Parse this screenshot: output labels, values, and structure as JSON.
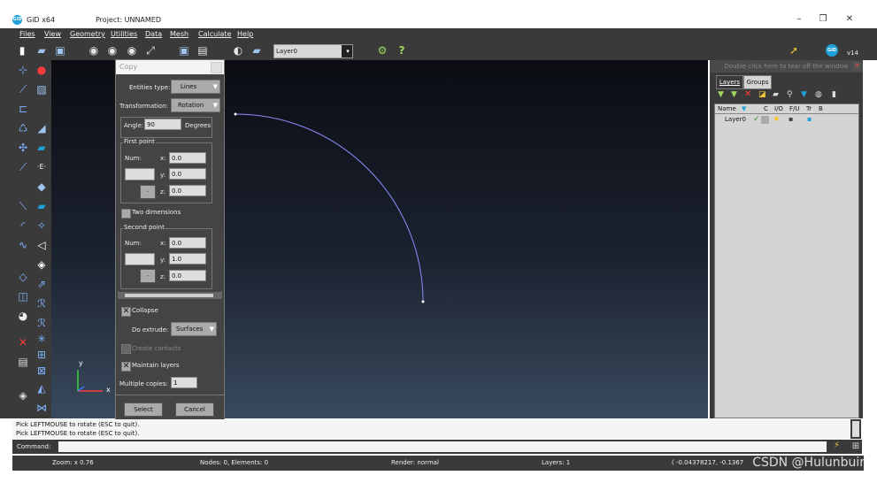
{
  "window": {
    "app_name": "GiD x64",
    "logo_text": "GiD",
    "project": "Project: UNNAMED",
    "controls": {
      "minimize": "–",
      "maximize": "❐",
      "close": "✕"
    }
  },
  "menu": [
    "Files",
    "View",
    "Geometry",
    "Utilities",
    "Data",
    "Mesh",
    "Calculate",
    "Help"
  ],
  "toolbar": {
    "layer_select": "Layer0",
    "version": "v14",
    "logo": "GiD"
  },
  "dialog": {
    "title": "Copy",
    "entities_type_label": "Entities type:",
    "entities_type_value": "Lines",
    "transformation_label": "Transformation:",
    "transformation_value": "Rotation",
    "angle_label": "Angle:",
    "angle_value": "90",
    "angle_unit": "Degrees",
    "first_point": {
      "label": "First point",
      "num_label": "Num:",
      "x_label": "x:",
      "x_value": "0.0",
      "y_label": "y:",
      "y_value": "0.0",
      "z_label": "z:",
      "z_value": "0.0",
      "pick_button": "·"
    },
    "two_dimensions_label": "Two dimensions",
    "second_point": {
      "label": "Second point",
      "num_label": "Num:",
      "x_label": "x:",
      "x_value": "0.0",
      "y_label": "y:",
      "y_value": "1.0",
      "z_label": "z:",
      "z_value": "0.0",
      "pick_button": "·"
    },
    "collapse_label": "Collapse",
    "do_extrude_label": "Do extrude:",
    "do_extrude_value": "Surfaces",
    "create_contacts_label": "Create contacts",
    "maintain_layers_label": "Maintain layers",
    "multiple_copies_label": "Multiple copies:",
    "multiple_copies_value": "1",
    "select_button": "Select",
    "cancel_button": "Cancel"
  },
  "axes": {
    "x": "x",
    "y": "y"
  },
  "panel": {
    "tearoff": "Double click here to tear off the window",
    "tabs": [
      "Layers",
      "Groups"
    ],
    "columns": [
      "Name",
      "C",
      "I/O",
      "F/U",
      "Tr",
      "B"
    ],
    "layers": [
      {
        "name": "Layer0"
      }
    ]
  },
  "messages": [
    "Pick LEFTMOUSE to rotate (ESC to quit).",
    "Pick LEFTMOUSE to rotate (ESC to quit)."
  ],
  "command_label": "Command:",
  "status": {
    "zoom": "Zoom: x 0.76",
    "nodes": "Nodes: 0, Elements: 0",
    "render": "Render: normal",
    "layers": "Layers: 1",
    "coords": "( -0.04378217, -0.1367"
  },
  "watermark": "CSDN @Hulunbuir",
  "colors": {
    "dark_bg": "#3a3a3a",
    "accent": "#1ea0d8",
    "curve": "#8c8cff"
  }
}
